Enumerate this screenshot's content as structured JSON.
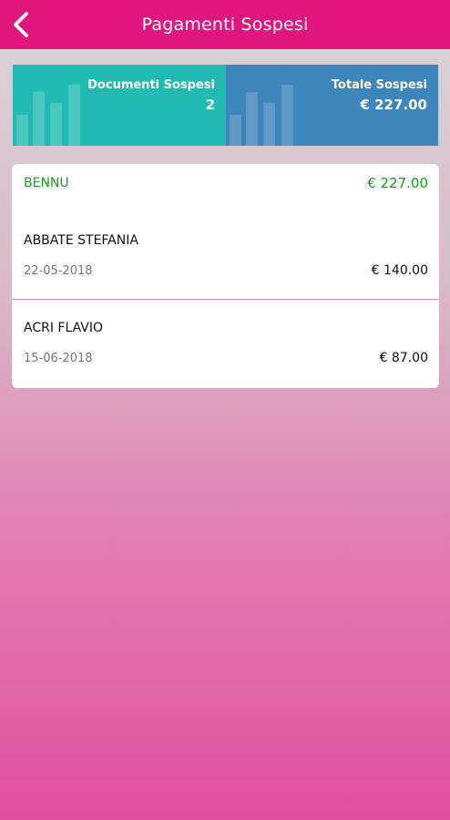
{
  "header": {
    "title": "Pagamenti Sospesi",
    "back_icon": "chevron-left-icon"
  },
  "summary": {
    "documents_label": "Documenti Sospesi",
    "documents_value": "2",
    "total_label": "Totale Sospesi",
    "total_value": "€ 227.00",
    "colors": {
      "documents": "#22bbb3",
      "total": "#3d86bb"
    }
  },
  "group": {
    "name": "BENNU",
    "total": "€ 227.00",
    "color": "#15a01e"
  },
  "items": [
    {
      "name": "ABBATE STEFANIA",
      "date": "22-05-2018",
      "amount": "€ 140.00"
    },
    {
      "name": "ACRI FLAVIO",
      "date": "15-06-2018",
      "amount": "€ 87.00"
    }
  ],
  "colors": {
    "accent": "#e0167f"
  }
}
